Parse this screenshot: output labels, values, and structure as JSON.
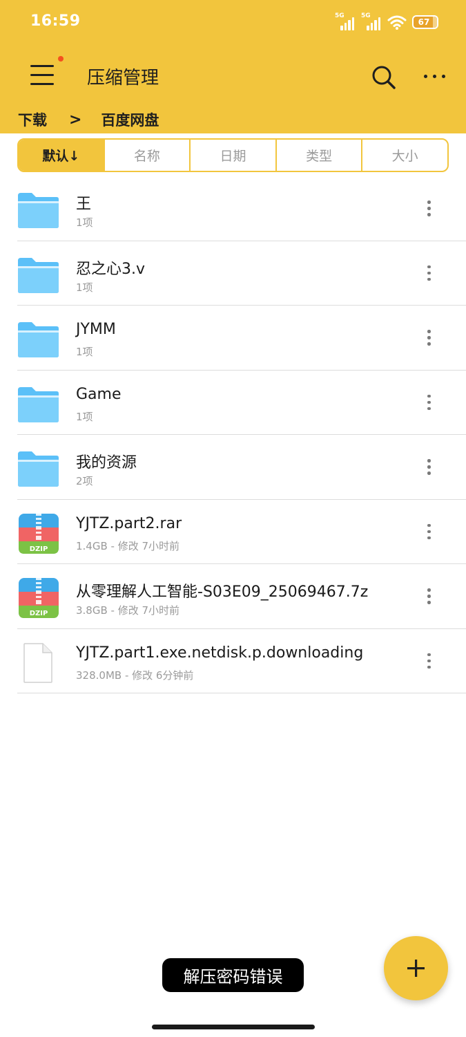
{
  "status_bar": {
    "time": "16:59",
    "signal_1_label": "5G",
    "signal_2_label": "5G",
    "battery": "67",
    "icons": [
      "signal-icon",
      "signal-icon",
      "wifi-icon",
      "battery-icon"
    ]
  },
  "app_bar": {
    "title": "压缩管理",
    "icons": [
      "menu-icon",
      "search-icon",
      "more-icon"
    ],
    "notification_dot_color": "#F4511E"
  },
  "breadcrumb": {
    "items": [
      "下载",
      "百度网盘"
    ],
    "separator": ">"
  },
  "sort_tabs": [
    {
      "label": "默认↓",
      "active": true
    },
    {
      "label": "名称",
      "active": false
    },
    {
      "label": "日期",
      "active": false
    },
    {
      "label": "类型",
      "active": false
    },
    {
      "label": "大小",
      "active": false
    }
  ],
  "files": [
    {
      "name": "王",
      "meta": "1项",
      "type": "folder"
    },
    {
      "name": "忍之心3.v",
      "meta": "1项",
      "type": "folder"
    },
    {
      "name": "JYMM",
      "meta": "1项",
      "type": "folder"
    },
    {
      "name": "Game",
      "meta": "1项",
      "type": "folder"
    },
    {
      "name": "我的资源",
      "meta": "2项",
      "type": "folder"
    },
    {
      "name": "YJTZ.part2.rar",
      "meta": "1.4GB - 修改 7小时前",
      "type": "archive",
      "archive_label": "DZIP"
    },
    {
      "name": "从零理解人工智能-S03E09_25069467.7z",
      "meta": "3.8GB - 修改 7小时前",
      "type": "archive",
      "archive_label": "DZIP"
    },
    {
      "name": "YJTZ.part1.exe.netdisk.p.downloading",
      "meta": "328.0MB - 修改 6分钟前",
      "type": "file"
    }
  ],
  "toast": "解压密码错误",
  "fab_icon": "plus-icon",
  "colors": {
    "accent": "#F2C53D",
    "folder": "#5BC0F8",
    "archive_top": "#3FA9E8",
    "archive_mid": "#F06464",
    "archive_bottom": "#7CC245"
  }
}
